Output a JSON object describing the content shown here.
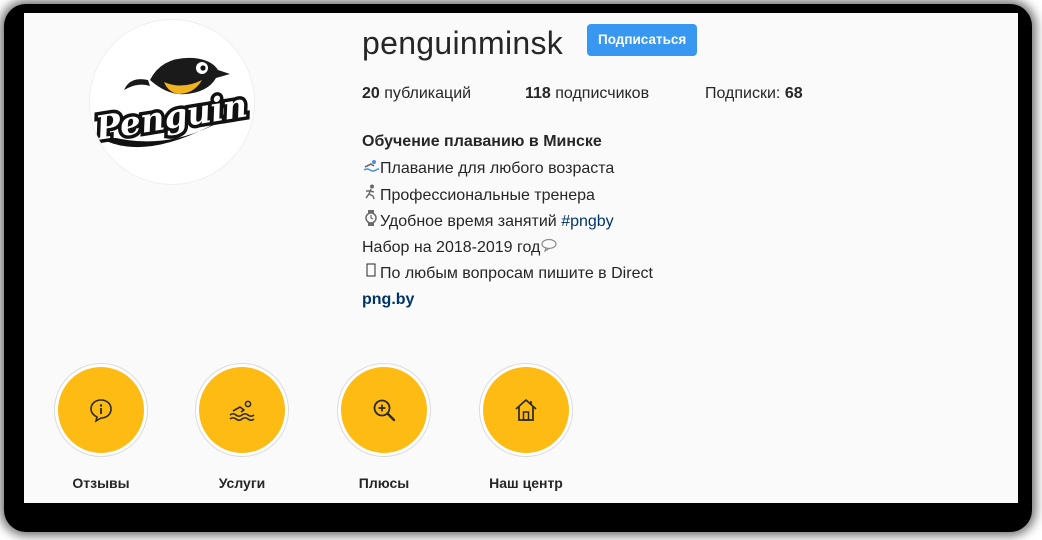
{
  "profile": {
    "username": "penguinminsk",
    "follow_label": "Подписаться",
    "avatar_logo_text": "Penguin"
  },
  "stats": {
    "posts_count": "20",
    "posts_label": " публикаций",
    "followers_count": "118",
    "followers_label": " подписчиков",
    "following_label": "Подписки: ",
    "following_count": "68"
  },
  "bio": {
    "name": "Обучение плаванию в Минске",
    "line1": "Плавание для любого возраста",
    "line2": "Профессиональные тренера",
    "line3_text": "Удобное время занятий ",
    "line3_hashtag": "#pngby",
    "line4": "Набор на 2018-2019 год",
    "line5": "По любым вопросам пишите в Direct",
    "link": "png.by"
  },
  "highlights": [
    {
      "label": "Отзывы",
      "icon": "info-icon"
    },
    {
      "label": "Услуги",
      "icon": "swimmer-icon"
    },
    {
      "label": "Плюсы",
      "icon": "zoom-in-icon"
    },
    {
      "label": "Наш центр",
      "icon": "home-icon"
    }
  ],
  "colors": {
    "follow_button": "#3897f0",
    "highlight_fill": "#fdbb13",
    "link": "#003569"
  }
}
